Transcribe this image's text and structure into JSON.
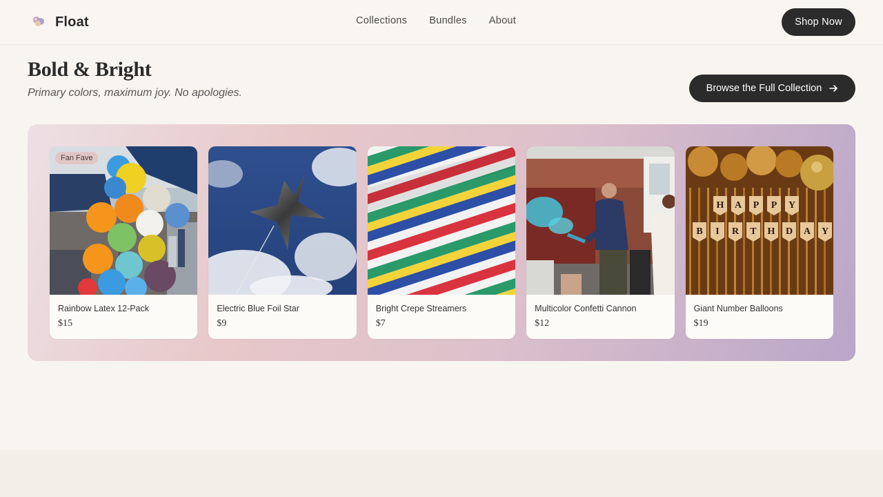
{
  "brand": {
    "name": "Float"
  },
  "nav": {
    "items": [
      "Collections",
      "Bundles",
      "About"
    ]
  },
  "header": {
    "cta_label": "Shop Now"
  },
  "section": {
    "title": "Bold & Bright",
    "subtitle": "Primary colors, maximum joy. No apologies.",
    "browse_label": "Browse the Full Collection"
  },
  "products": [
    {
      "name": "Rainbow Latex 12-Pack",
      "price": "$15",
      "badge": "Fan Fave",
      "image": "colorful-balloon-bunch-photo"
    },
    {
      "name": "Electric Blue Foil Star",
      "price": "$9",
      "image": "silver-foil-star-balloon-sky-photo"
    },
    {
      "name": "Bright Crepe Streamers",
      "price": "$7",
      "image": "striped-fabric-photo"
    },
    {
      "name": "Multicolor Confetti Cannon",
      "price": "$12",
      "image": "confetti-cannon-backyard-photo"
    },
    {
      "name": "Giant Number Balloons",
      "price": "$19",
      "image": "gold-happy-birthday-banner-photo"
    }
  ],
  "colors": {
    "background": "#f8f5f0",
    "button_dark": "#2b2b2b",
    "panel_gradient": [
      "#ece0e4",
      "#e8c8c9",
      "#b9a6c9"
    ],
    "badge": "#e2c3c3"
  }
}
